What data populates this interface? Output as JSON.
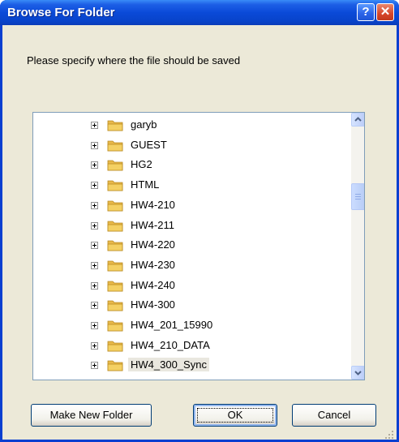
{
  "window": {
    "title": "Browse For Folder",
    "help_label": "?",
    "close_label": "✕"
  },
  "dialog": {
    "prompt": "Please specify where the file should be saved"
  },
  "tree": {
    "items": [
      {
        "label": "garyb"
      },
      {
        "label": "GUEST"
      },
      {
        "label": "HG2"
      },
      {
        "label": "HTML"
      },
      {
        "label": "HW4-210"
      },
      {
        "label": "HW4-211"
      },
      {
        "label": "HW4-220"
      },
      {
        "label": "HW4-230"
      },
      {
        "label": "HW4-240"
      },
      {
        "label": "HW4-300"
      },
      {
        "label": "HW4_201_15990"
      },
      {
        "label": "HW4_210_DATA"
      },
      {
        "label": "HW4_300_Sync",
        "selected": true
      }
    ],
    "icons": {
      "expander": "plus-box-icon",
      "folder": "folder-icon"
    },
    "folder_color": "#f4d063"
  },
  "buttons": {
    "make_new_folder": "Make New Folder",
    "ok": "OK",
    "cancel": "Cancel"
  },
  "colors": {
    "title_bar": "#0a4ad8",
    "dialog_background": "#ece9d8",
    "close_button": "#d6452a"
  }
}
